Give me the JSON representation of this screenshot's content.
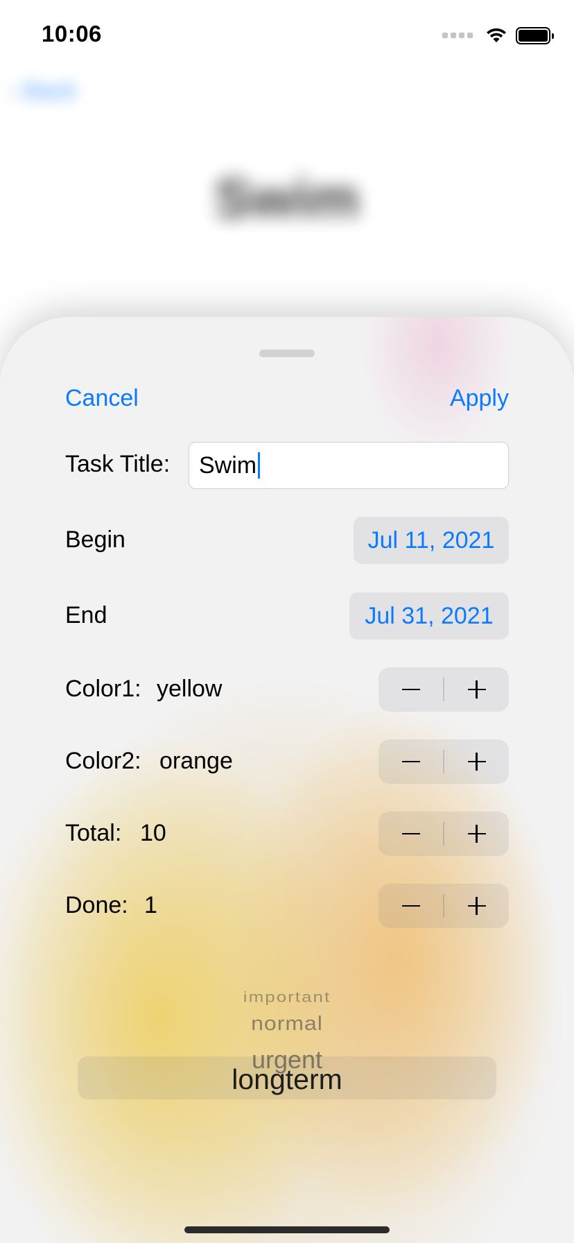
{
  "status_bar": {
    "time": "10:06"
  },
  "background_page": {
    "title": "Swim"
  },
  "sheet": {
    "cancel_label": "Cancel",
    "apply_label": "Apply",
    "task_title": {
      "label": "Task Title:",
      "value": "Swim"
    },
    "begin": {
      "label": "Begin",
      "date": "Jul 11, 2021"
    },
    "end": {
      "label": "End",
      "date": "Jul 31, 2021"
    },
    "color1": {
      "label": "Color1:",
      "value": "yellow"
    },
    "color2": {
      "label": "Color2:",
      "value": "orange"
    },
    "total": {
      "label": "Total:",
      "value": "10"
    },
    "done": {
      "label": "Done:",
      "value": "1"
    },
    "priority_picker": {
      "options": [
        "important",
        "normal",
        "urgent",
        "longterm"
      ],
      "selected": "longterm"
    }
  },
  "colors": {
    "accent": "#0a7aff"
  }
}
